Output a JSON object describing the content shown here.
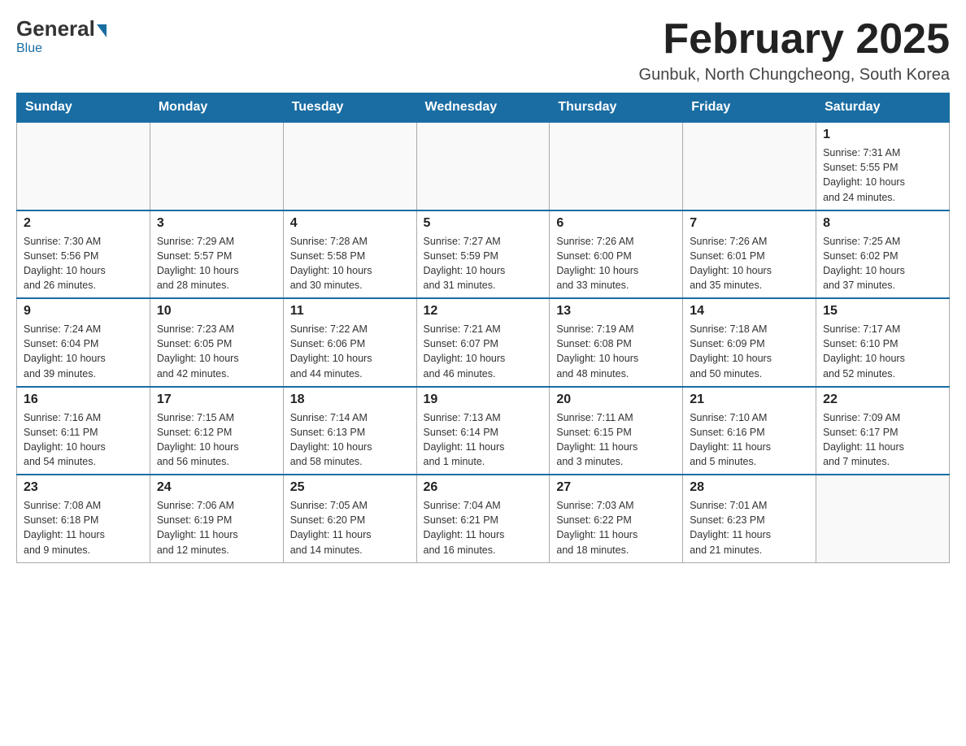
{
  "header": {
    "logo_general": "General",
    "logo_blue": "Blue",
    "month_title": "February 2025",
    "location": "Gunbuk, North Chungcheong, South Korea"
  },
  "days_of_week": [
    "Sunday",
    "Monday",
    "Tuesday",
    "Wednesday",
    "Thursday",
    "Friday",
    "Saturday"
  ],
  "weeks": [
    [
      {
        "day": "",
        "info": ""
      },
      {
        "day": "",
        "info": ""
      },
      {
        "day": "",
        "info": ""
      },
      {
        "day": "",
        "info": ""
      },
      {
        "day": "",
        "info": ""
      },
      {
        "day": "",
        "info": ""
      },
      {
        "day": "1",
        "info": "Sunrise: 7:31 AM\nSunset: 5:55 PM\nDaylight: 10 hours\nand 24 minutes."
      }
    ],
    [
      {
        "day": "2",
        "info": "Sunrise: 7:30 AM\nSunset: 5:56 PM\nDaylight: 10 hours\nand 26 minutes."
      },
      {
        "day": "3",
        "info": "Sunrise: 7:29 AM\nSunset: 5:57 PM\nDaylight: 10 hours\nand 28 minutes."
      },
      {
        "day": "4",
        "info": "Sunrise: 7:28 AM\nSunset: 5:58 PM\nDaylight: 10 hours\nand 30 minutes."
      },
      {
        "day": "5",
        "info": "Sunrise: 7:27 AM\nSunset: 5:59 PM\nDaylight: 10 hours\nand 31 minutes."
      },
      {
        "day": "6",
        "info": "Sunrise: 7:26 AM\nSunset: 6:00 PM\nDaylight: 10 hours\nand 33 minutes."
      },
      {
        "day": "7",
        "info": "Sunrise: 7:26 AM\nSunset: 6:01 PM\nDaylight: 10 hours\nand 35 minutes."
      },
      {
        "day": "8",
        "info": "Sunrise: 7:25 AM\nSunset: 6:02 PM\nDaylight: 10 hours\nand 37 minutes."
      }
    ],
    [
      {
        "day": "9",
        "info": "Sunrise: 7:24 AM\nSunset: 6:04 PM\nDaylight: 10 hours\nand 39 minutes."
      },
      {
        "day": "10",
        "info": "Sunrise: 7:23 AM\nSunset: 6:05 PM\nDaylight: 10 hours\nand 42 minutes."
      },
      {
        "day": "11",
        "info": "Sunrise: 7:22 AM\nSunset: 6:06 PM\nDaylight: 10 hours\nand 44 minutes."
      },
      {
        "day": "12",
        "info": "Sunrise: 7:21 AM\nSunset: 6:07 PM\nDaylight: 10 hours\nand 46 minutes."
      },
      {
        "day": "13",
        "info": "Sunrise: 7:19 AM\nSunset: 6:08 PM\nDaylight: 10 hours\nand 48 minutes."
      },
      {
        "day": "14",
        "info": "Sunrise: 7:18 AM\nSunset: 6:09 PM\nDaylight: 10 hours\nand 50 minutes."
      },
      {
        "day": "15",
        "info": "Sunrise: 7:17 AM\nSunset: 6:10 PM\nDaylight: 10 hours\nand 52 minutes."
      }
    ],
    [
      {
        "day": "16",
        "info": "Sunrise: 7:16 AM\nSunset: 6:11 PM\nDaylight: 10 hours\nand 54 minutes."
      },
      {
        "day": "17",
        "info": "Sunrise: 7:15 AM\nSunset: 6:12 PM\nDaylight: 10 hours\nand 56 minutes."
      },
      {
        "day": "18",
        "info": "Sunrise: 7:14 AM\nSunset: 6:13 PM\nDaylight: 10 hours\nand 58 minutes."
      },
      {
        "day": "19",
        "info": "Sunrise: 7:13 AM\nSunset: 6:14 PM\nDaylight: 11 hours\nand 1 minute."
      },
      {
        "day": "20",
        "info": "Sunrise: 7:11 AM\nSunset: 6:15 PM\nDaylight: 11 hours\nand 3 minutes."
      },
      {
        "day": "21",
        "info": "Sunrise: 7:10 AM\nSunset: 6:16 PM\nDaylight: 11 hours\nand 5 minutes."
      },
      {
        "day": "22",
        "info": "Sunrise: 7:09 AM\nSunset: 6:17 PM\nDaylight: 11 hours\nand 7 minutes."
      }
    ],
    [
      {
        "day": "23",
        "info": "Sunrise: 7:08 AM\nSunset: 6:18 PM\nDaylight: 11 hours\nand 9 minutes."
      },
      {
        "day": "24",
        "info": "Sunrise: 7:06 AM\nSunset: 6:19 PM\nDaylight: 11 hours\nand 12 minutes."
      },
      {
        "day": "25",
        "info": "Sunrise: 7:05 AM\nSunset: 6:20 PM\nDaylight: 11 hours\nand 14 minutes."
      },
      {
        "day": "26",
        "info": "Sunrise: 7:04 AM\nSunset: 6:21 PM\nDaylight: 11 hours\nand 16 minutes."
      },
      {
        "day": "27",
        "info": "Sunrise: 7:03 AM\nSunset: 6:22 PM\nDaylight: 11 hours\nand 18 minutes."
      },
      {
        "day": "28",
        "info": "Sunrise: 7:01 AM\nSunset: 6:23 PM\nDaylight: 11 hours\nand 21 minutes."
      },
      {
        "day": "",
        "info": ""
      }
    ]
  ]
}
